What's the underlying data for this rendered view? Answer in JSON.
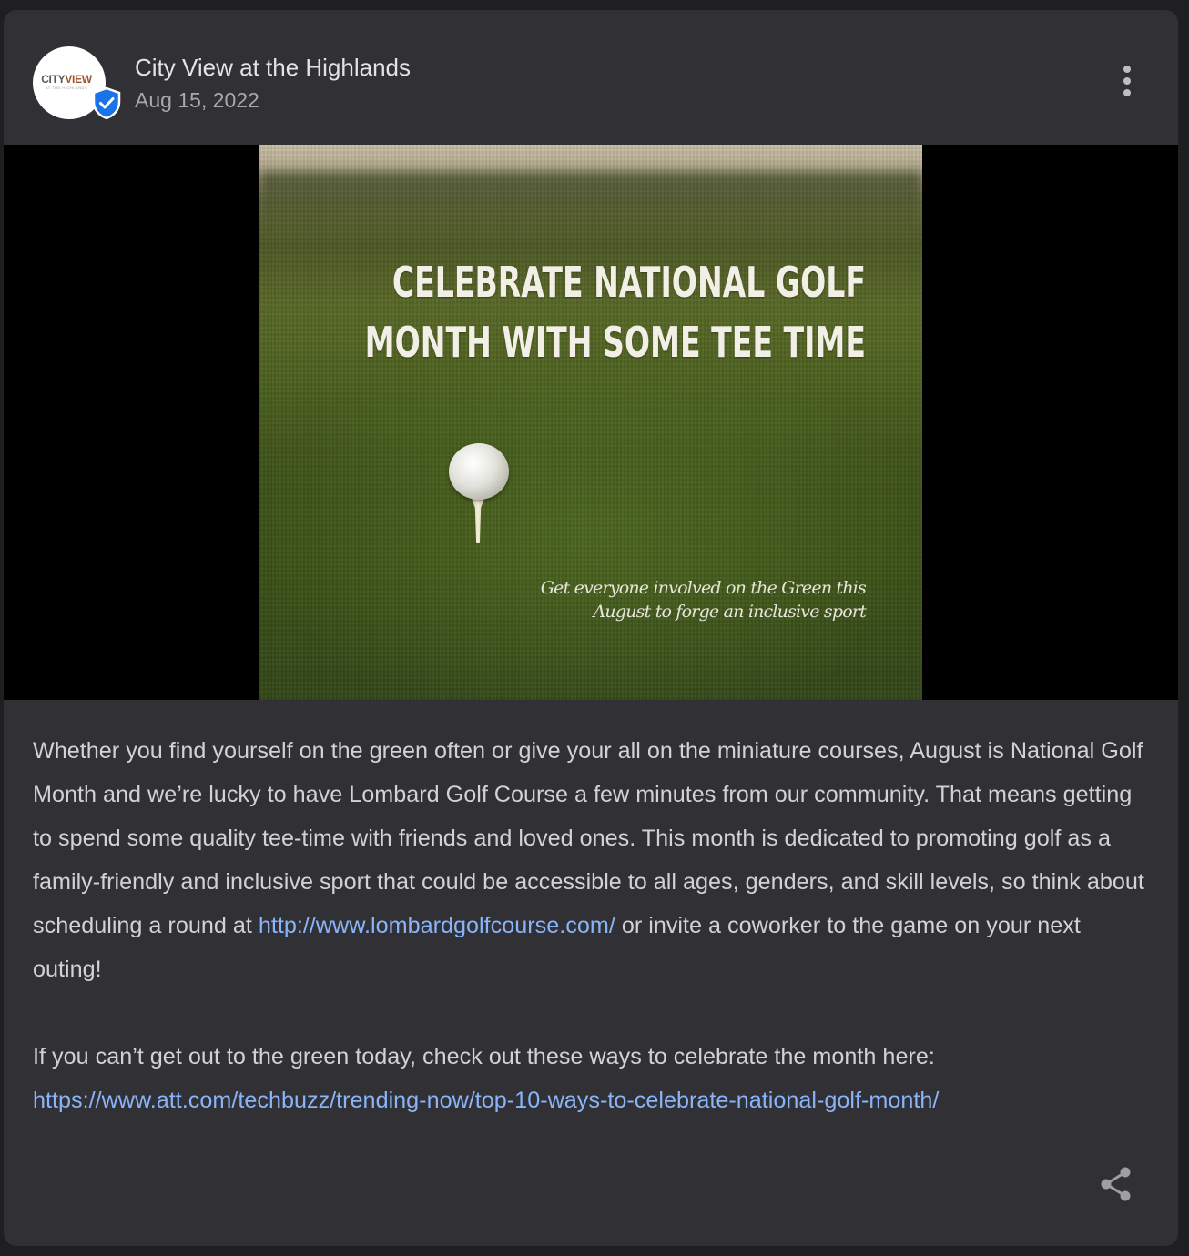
{
  "post": {
    "business_name": "City View at the Highlands",
    "date": "Aug 15, 2022",
    "avatar": {
      "logo_text_a": "CITY",
      "logo_text_b": "VIEW",
      "logo_subtext": "AT THE HIGHLANDS"
    },
    "verified_icon": "verified-shield-icon",
    "more_icon": "more-vert-icon",
    "image": {
      "headline_line1": "CELEBRATE NATIONAL GOLF",
      "headline_line2": "MONTH WITH SOME TEE TIME",
      "subline_line1": "Get everyone involved on the Green this",
      "subline_line2": "August to forge an inclusive sport"
    },
    "body": {
      "paragraph1_text": "Whether you find yourself on the green often or give your all on the miniature courses, August is National Golf Month and we’re lucky to have Lombard Golf Course a few minutes from our community. That means getting to spend some quality tee-time with friends and loved ones. This month is dedicated to promoting golf as a family-friendly and inclusive sport that could be accessible to all ages, genders, and skill levels, so think about scheduling a round at ",
      "paragraph1_link": "http://www.lombardgolfcourse.com/",
      "paragraph1_after": " or invite a coworker to the game on your next outing!",
      "paragraph2_text": "If you can’t get out to the green today, check out these ways to celebrate the month here: ",
      "paragraph2_link": "https://www.att.com/techbuzz/trending-now/top-10-ways-to-celebrate-national-golf-month/"
    },
    "share_icon": "share-icon"
  },
  "colors": {
    "card_bg": "#303035",
    "page_bg": "#1f1f22",
    "link": "#8ab4f8",
    "text": "#d2d2d6",
    "verified": "#1a73e8"
  }
}
